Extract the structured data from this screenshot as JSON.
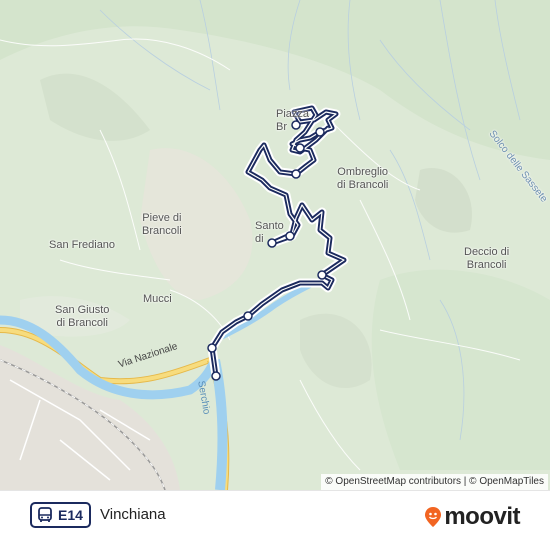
{
  "map": {
    "places": {
      "piazza_line1": "Piazza",
      "piazza_line2": "Br",
      "ombreglio_line1": "Ombreglio",
      "ombreglio_line2": "di Brancoli",
      "pieve_line1": "Pieve di",
      "pieve_line2": "Brancoli",
      "santo_line1": "Santo",
      "santo_line2": "di",
      "san_frediano": "San Frediano",
      "deccio_line1": "Deccio di",
      "deccio_line2": "Brancoli",
      "mucci": "Mucci",
      "san_giusto_line1": "San Giusto",
      "san_giusto_line2": "di Brancoli",
      "solco": "Solco delle Sassete"
    },
    "roads": {
      "via_nazionale": "Via Nazionale",
      "serchio": "Serchio"
    },
    "attribution": "© OpenStreetMap contributors | © OpenMapTiles",
    "colors": {
      "route": "#1b2a5e",
      "river": "#8cc4e8",
      "highway": "#f5d36a",
      "land": "#dfe9d9"
    }
  },
  "footer": {
    "route_icon": "bus-icon",
    "route_code": "E14",
    "destination": "Vinchiana",
    "brand": "moovit",
    "brand_icon": "moovit-pin-icon"
  }
}
